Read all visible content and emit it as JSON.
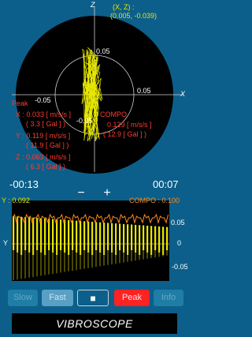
{
  "scope": {
    "axis_z": "Z",
    "axis_x": "X",
    "coord_label": "(X, Z) :",
    "coord_value": "(0.005, -0.039)",
    "tick_top": "0.05",
    "tick_right": "0.05",
    "tick_left": "-0.05",
    "tick_bottom": "-0.05"
  },
  "peak": {
    "label": "Peak",
    "x_line": "X : 0.033 [ m/s/s ]",
    "x_gal": "( 3.3 [ Gal ] )",
    "y_line": "Y : 0.119 [ m/s/s ]",
    "y_gal": "( 11.9 [ Gal ] )",
    "z_line": "Z : 0.063 [ m/s/s ]",
    "z_gal": "( 6.3 [ Gal ] )",
    "compo_label": "COMPO",
    "compo_line": "0.129 [ m/s/s ]",
    "compo_gal": "( 12.9 [ Gal ] )"
  },
  "time": {
    "left": "-00:13",
    "right": "00:07",
    "minus": "−",
    "plus": "+"
  },
  "wave": {
    "y_value": "Y : 0.092",
    "compo_value": "COMPO : 0.100",
    "axis_label": "Y",
    "tick_pos": "0.05",
    "tick_zero": "0",
    "tick_neg": "-0.05"
  },
  "modes": {
    "slow": "Slow",
    "fast": "Fast",
    "stop": "■",
    "peak": "Peak",
    "info": "Info"
  },
  "title": "VIBROSCOPE",
  "colors": {
    "background": "#0c5f8a",
    "accent_red": "#ff3b2f",
    "trace_yellow": "#e6e600",
    "peak_button": "#ff2222"
  }
}
